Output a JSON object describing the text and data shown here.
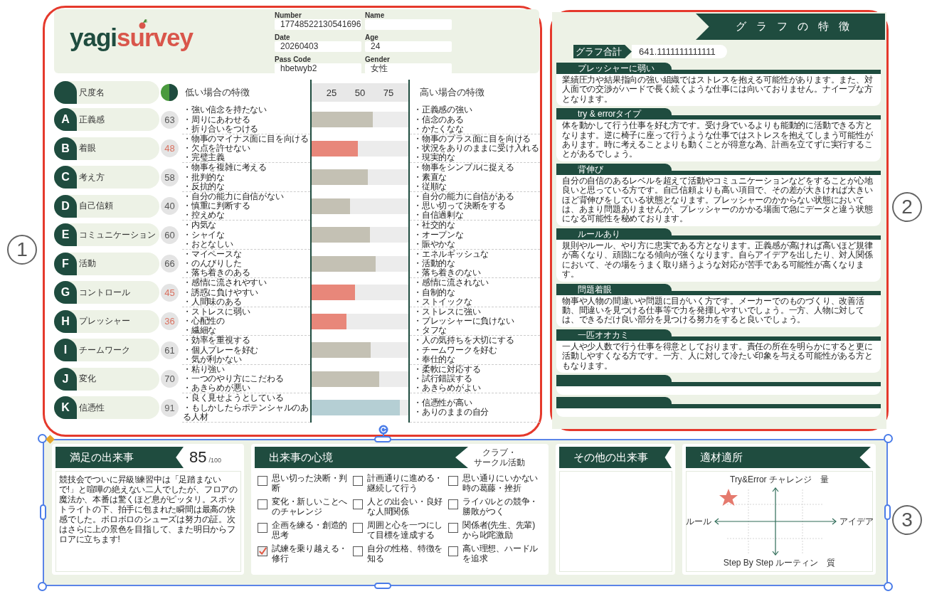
{
  "logo": {
    "text": "yagi",
    "accent_text": "survey"
  },
  "profile_fields": [
    {
      "label": "Number",
      "value": "17748522130541696"
    },
    {
      "label": "Name"
    },
    {
      "label": "Date",
      "value": "20260403"
    },
    {
      "label": "Age",
      "value": "24"
    },
    {
      "label": "Pass Code",
      "value": "hbetwyb2"
    },
    {
      "label": "Gender",
      "value": "女性"
    }
  ],
  "scale_header": {
    "name_label": "尺度名",
    "low_label": "低い場合の特徴",
    "ticks": [
      "25",
      "50",
      "75"
    ],
    "high_label": "高い場合の特徴"
  },
  "scales": [
    {
      "letter": "A",
      "name": "正義感",
      "score": "63",
      "level": 0.63,
      "kind": "normal",
      "low": [
        "・強い信念を持たない",
        "・周りにあわせる",
        "・折り合いをつける"
      ],
      "high": [
        "・正義感の強い",
        "・信念のある",
        "・かたくなな"
      ]
    },
    {
      "letter": "B",
      "name": "着眼",
      "score": "48",
      "level": 0.48,
      "kind": "low",
      "low": [
        "・物事のマイナス面に目を向ける",
        "・欠点を許せない",
        "・完璧主義"
      ],
      "high": [
        "・物事のプラス面に目を向ける",
        "・状況をありのままに受け入れる",
        "・現実的な"
      ]
    },
    {
      "letter": "C",
      "name": "考え方",
      "score": "58",
      "level": 0.58,
      "kind": "normal",
      "low": [
        "・物事を複雑に考える",
        "・批判的な",
        "・反抗的な"
      ],
      "high": [
        "・物事をシンプルに捉える",
        "・素直な",
        "・従順な"
      ]
    },
    {
      "letter": "D",
      "name": "自己信頼",
      "score": "40",
      "level": 0.4,
      "kind": "normal",
      "low": [
        "・自分の能力に自信がない",
        "・慎重に判断する",
        "・控えめな"
      ],
      "high": [
        "・自分の能力に自信がある",
        "・思い切って決断をする",
        "・自信過剰な"
      ]
    },
    {
      "letter": "E",
      "name": "コミュニケーション",
      "score": "60",
      "level": 0.6,
      "kind": "normal",
      "low": [
        "・内気な",
        "・シャイな",
        "・おとなしい"
      ],
      "high": [
        "・社交的な",
        "・オープンな",
        "・賑やかな"
      ]
    },
    {
      "letter": "F",
      "name": "活動",
      "score": "66",
      "level": 0.66,
      "kind": "normal",
      "low": [
        "・マイペースな",
        "・のんびりした",
        "・落ち着きのある"
      ],
      "high": [
        "・エネルギッシュな",
        "・活動的な",
        "・落ち着きのない"
      ]
    },
    {
      "letter": "G",
      "name": "コントロール",
      "score": "45",
      "level": 0.45,
      "kind": "low",
      "low": [
        "・感情に流されやすい",
        "・誘惑に負けやすい",
        "・人間味のある"
      ],
      "high": [
        "・感情に流されない",
        "・自制的な",
        "・ストイックな"
      ]
    },
    {
      "letter": "H",
      "name": "プレッシャー",
      "score": "36",
      "level": 0.36,
      "kind": "low",
      "low": [
        "・ストレスに弱い",
        "・心配性の",
        "・繊細な"
      ],
      "high": [
        "・ストレスに強い",
        "・プレッシャーに負けない",
        "・タフな"
      ]
    },
    {
      "letter": "I",
      "name": "チームワーク",
      "score": "61",
      "level": 0.61,
      "kind": "normal",
      "low": [
        "・効率を重視する",
        "・個人プレーを好む",
        "・気が利かない"
      ],
      "high": [
        "・人の気持ちを大切にする",
        "・チームワークを好む",
        "・奉仕的な"
      ]
    },
    {
      "letter": "J",
      "name": "変化",
      "score": "70",
      "level": 0.7,
      "kind": "normal",
      "low": [
        "・粘り強い",
        "・一つのやり方にこだわる",
        "・あきらめが悪い"
      ],
      "high": [
        "・柔軟に対応する",
        "・試行錯誤する",
        "・あきらめがよい"
      ]
    },
    {
      "letter": "K",
      "name": "信憑性",
      "score": "91",
      "level": 0.91,
      "kind": "high",
      "low": [
        "・良く見せようとしている",
        "・もしかしたらポテンシャルのある人材"
      ],
      "high": [
        "・信憑性が高い",
        "・ありのままの自分"
      ]
    }
  ],
  "graph_features": {
    "title": "グラフの特徴",
    "total_label": "グラフ合計",
    "total_value": "641.1111111111111",
    "cards": [
      {
        "title": "プレッシャーに弱い",
        "text": "業績圧力や結果指向の強い組織ではストレスを抱える可能性があります。また、対人面での交渉がハードで長く続くような仕事には向いておりません。ナイーブな方となります。"
      },
      {
        "title": "try & errorタイプ",
        "text": "体を動かして行う仕事を好む方です。受け身でいるよりも能動的に活動できる方となります。逆に椅子に座って行うような仕事ではストレスを抱えてしまう可能性があります。時に考えることよりも動くことが得意な為、計画を立てずに実行することがあるでしょう。"
      },
      {
        "title": "背伸び",
        "text": "自分の自信のあるレベルを超えて活動やコミュニケーションなどをすることが心地良いと思っている方です。自己信頼よりも高い項目で、その差が大きければ大きいほど背伸びをしている状態となります。プレッシャーのかからない状態においては、あまり問題ありませんが、プレッシャーのかかる場面で急にデータと違う状態になる可能性を秘めております。"
      },
      {
        "title": "ルールあり",
        "text": "規則やルール、やり方に忠実である方となります。正義感が高ければ高いほど規律が高くなり、頑固になる傾向が強くなります。自らアイデアを出したり、対人関係において、その場をうまく取り繕うような対応が苦手である可能性が高くなります。"
      },
      {
        "title": "問題着眼",
        "text": "物事や人物の間違いや問題に目がいく方です。メーカーでのものづくり、改善活動、間違いを見つける仕事等で力を発揮しやすいでしょう。一方、人物に対しては、できるだけ良い部分を見つける努力をすると良いでしょう。"
      },
      {
        "title": "一匹オオカミ",
        "text": "一人や少人数で行う仕事を得意としております。責任の所在を明らかにすると更に活動しやすくなる方です。一方、人に対して冷たい印象を与える可能性がある方ともなります。"
      }
    ]
  },
  "bottom": {
    "satisfaction": {
      "title": "満足の出来事",
      "score": "85",
      "score_max": "/100",
      "text": "競技会でついに昇級!練習中は「足踏まないで!」と喧嘩の絶えない二人でしたが、フロアの魔法か、本番は驚くほど息がピッタリ。スポットライトの下、拍手に包まれた瞬間は最高の快感でした。ボロボロのシューズは努力の証。次はさらに上の景色を目指して、また明日からフロアに立ちます!"
    },
    "mood": {
      "title": "出来事の心境",
      "category": [
        "クラブ・",
        "サークル活動"
      ],
      "options": [
        {
          "label": "思い切った決断・判断",
          "checked": false
        },
        {
          "label": "計画通りに進める・継続して行う",
          "checked": false
        },
        {
          "label": "思い通りにいかない時の葛藤・挫折",
          "checked": false
        },
        {
          "label": "変化・新しいことへのチャレンジ",
          "checked": false
        },
        {
          "label": "人との出会い・良好な人間関係",
          "checked": false
        },
        {
          "label": "ライバルとの競争・勝敗がつく",
          "checked": false
        },
        {
          "label": "企画を練る・創造的思考",
          "checked": false
        },
        {
          "label": "周囲と心を一つにして目標を達成する",
          "checked": false
        },
        {
          "label": "関係者(先生、先輩)から叱咤激励",
          "checked": false
        },
        {
          "label": "試練を乗り越える・修行",
          "checked": true
        },
        {
          "label": "自分の性格、特徴を知る",
          "checked": false
        },
        {
          "label": "高い理想、ハードルを追求",
          "checked": false
        }
      ]
    },
    "other": {
      "title": "その他の出来事"
    },
    "aptitude": {
      "title": "適材適所",
      "top_label": "Try&Error チャレンジ",
      "top_right_label": "量",
      "left_label": "ルール",
      "right_label": "アイデア",
      "bottom_label": "Step By Step ルーティン",
      "bottom_right_label": "質"
    }
  },
  "annotations": [
    {
      "label": "1"
    },
    {
      "label": "2"
    },
    {
      "label": "3"
    }
  ]
}
